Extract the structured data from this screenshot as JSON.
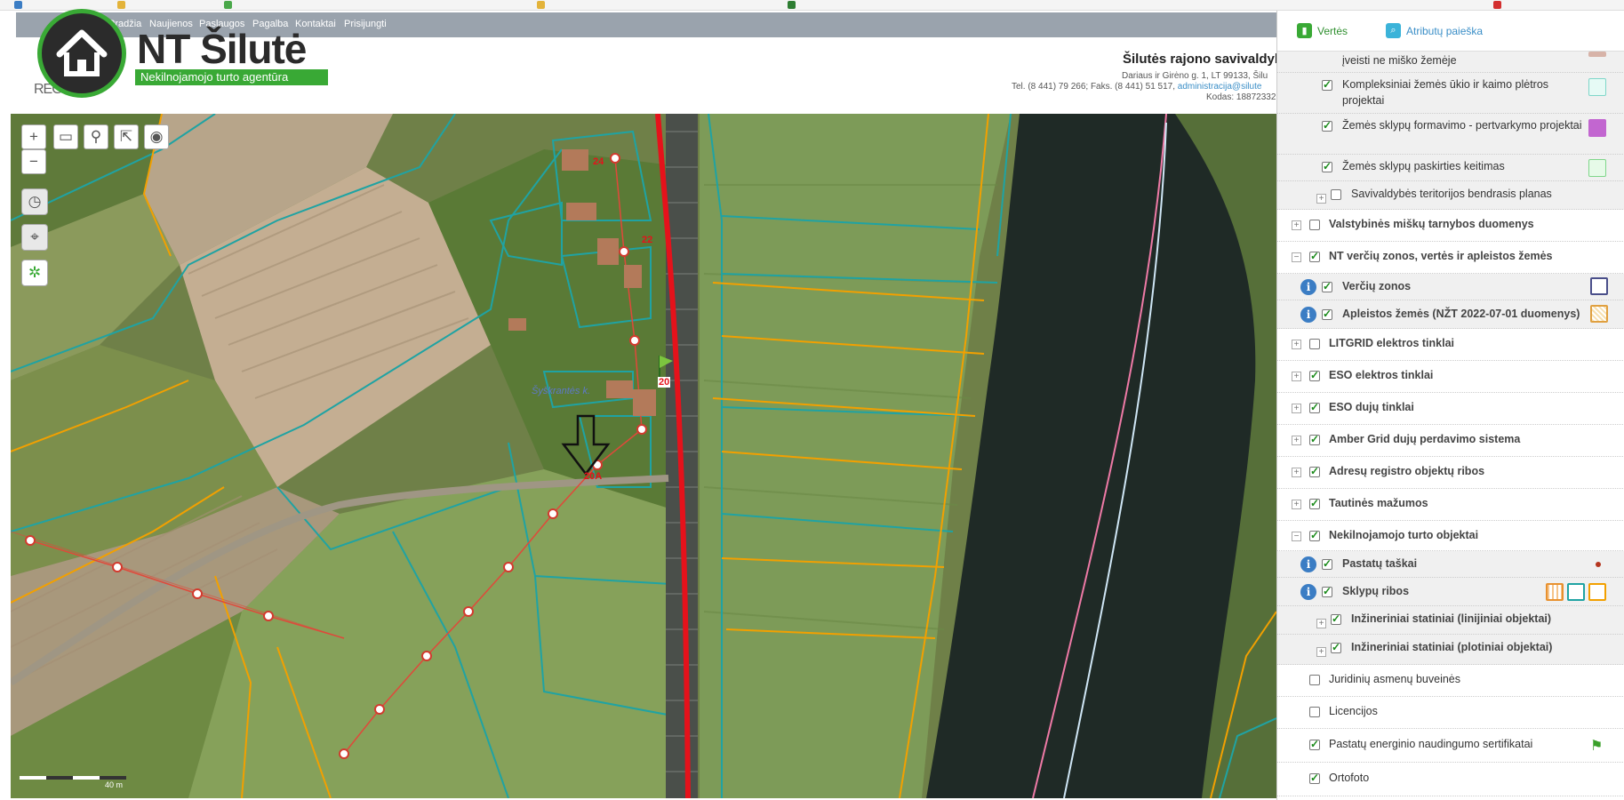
{
  "nav": {
    "items": [
      "Pradžia",
      "Naujienos",
      "Paslaugos",
      "Pagalba",
      "Kontaktai",
      "Prisijungti"
    ]
  },
  "brand": {
    "name": "NT Šilutė",
    "subtitle": "Nekilnojamojo turto agentūra",
    "partner": "REGIA"
  },
  "municipality": {
    "title": "Šilutės rajono savivaldyb",
    "address": "Dariaus ir Girėno g. 1, LT 99133, Šilu",
    "contacts": "Tel. (8 441) 79 266; Faks. (8 441) 51 517,",
    "email": "administracija@silute",
    "code": "Kodas: 18872332"
  },
  "map": {
    "labels": {
      "plot_24": "24",
      "plot_22": "22",
      "plot_20": "20",
      "plot_20a": "20A",
      "street": "Šyškrantės k.",
      "scale": "40 m"
    }
  },
  "panel": {
    "tabs": [
      {
        "label": "Vertės",
        "icon": "map-icon"
      },
      {
        "label": "Atributų paieška",
        "icon": "search-icon"
      }
    ],
    "layers": {
      "l1": "įveisti ne miško žemėje",
      "l2": "Kompleksiniai žemės ūkio ir kaimo plėtros projektai",
      "l3": "Žemės sklypų formavimo - pertvarkymo projektai",
      "l4": "Žemės sklypų paskirties keitimas",
      "l5": "Savivaldybės teritorijos bendrasis planas",
      "l6": "Valstybinės miškų tarnybos duomenys",
      "l7": "NT verčių zonos, vertės ir apleistos žemės",
      "l8": "Verčių zonos",
      "l9": "Apleistos žemės (NŽT 2022-07-01 duomenys)",
      "l10": "LITGRID elektros tinklai",
      "l11": "ESO elektros tinklai",
      "l12": "ESO dujų tinklai",
      "l13": "Amber Grid dujų perdavimo sistema",
      "l14": "Adresų registro objektų ribos",
      "l15": "Tautinės mažumos",
      "l16": "Nekilnojamojo turto objektai",
      "l17": "Pastatų taškai",
      "l18": "Sklypų ribos",
      "l19": "Inžineriniai statiniai (linijiniai objektai)",
      "l20": "Inžineriniai statiniai (plotiniai objektai)",
      "l21": "Juridinių asmenų buveinės",
      "l22": "Licencijos",
      "l23": "Pastatų energinio naudingumo sertifikatai",
      "l24": "Ortofoto"
    }
  },
  "colors": {
    "accent_green": "#39a935",
    "link_blue": "#3a8ec7",
    "plot_outline": "#1fa3a3",
    "zone_outline": "#f2a000",
    "railway_red": "#e5121b",
    "power_line": "#e0483a"
  }
}
